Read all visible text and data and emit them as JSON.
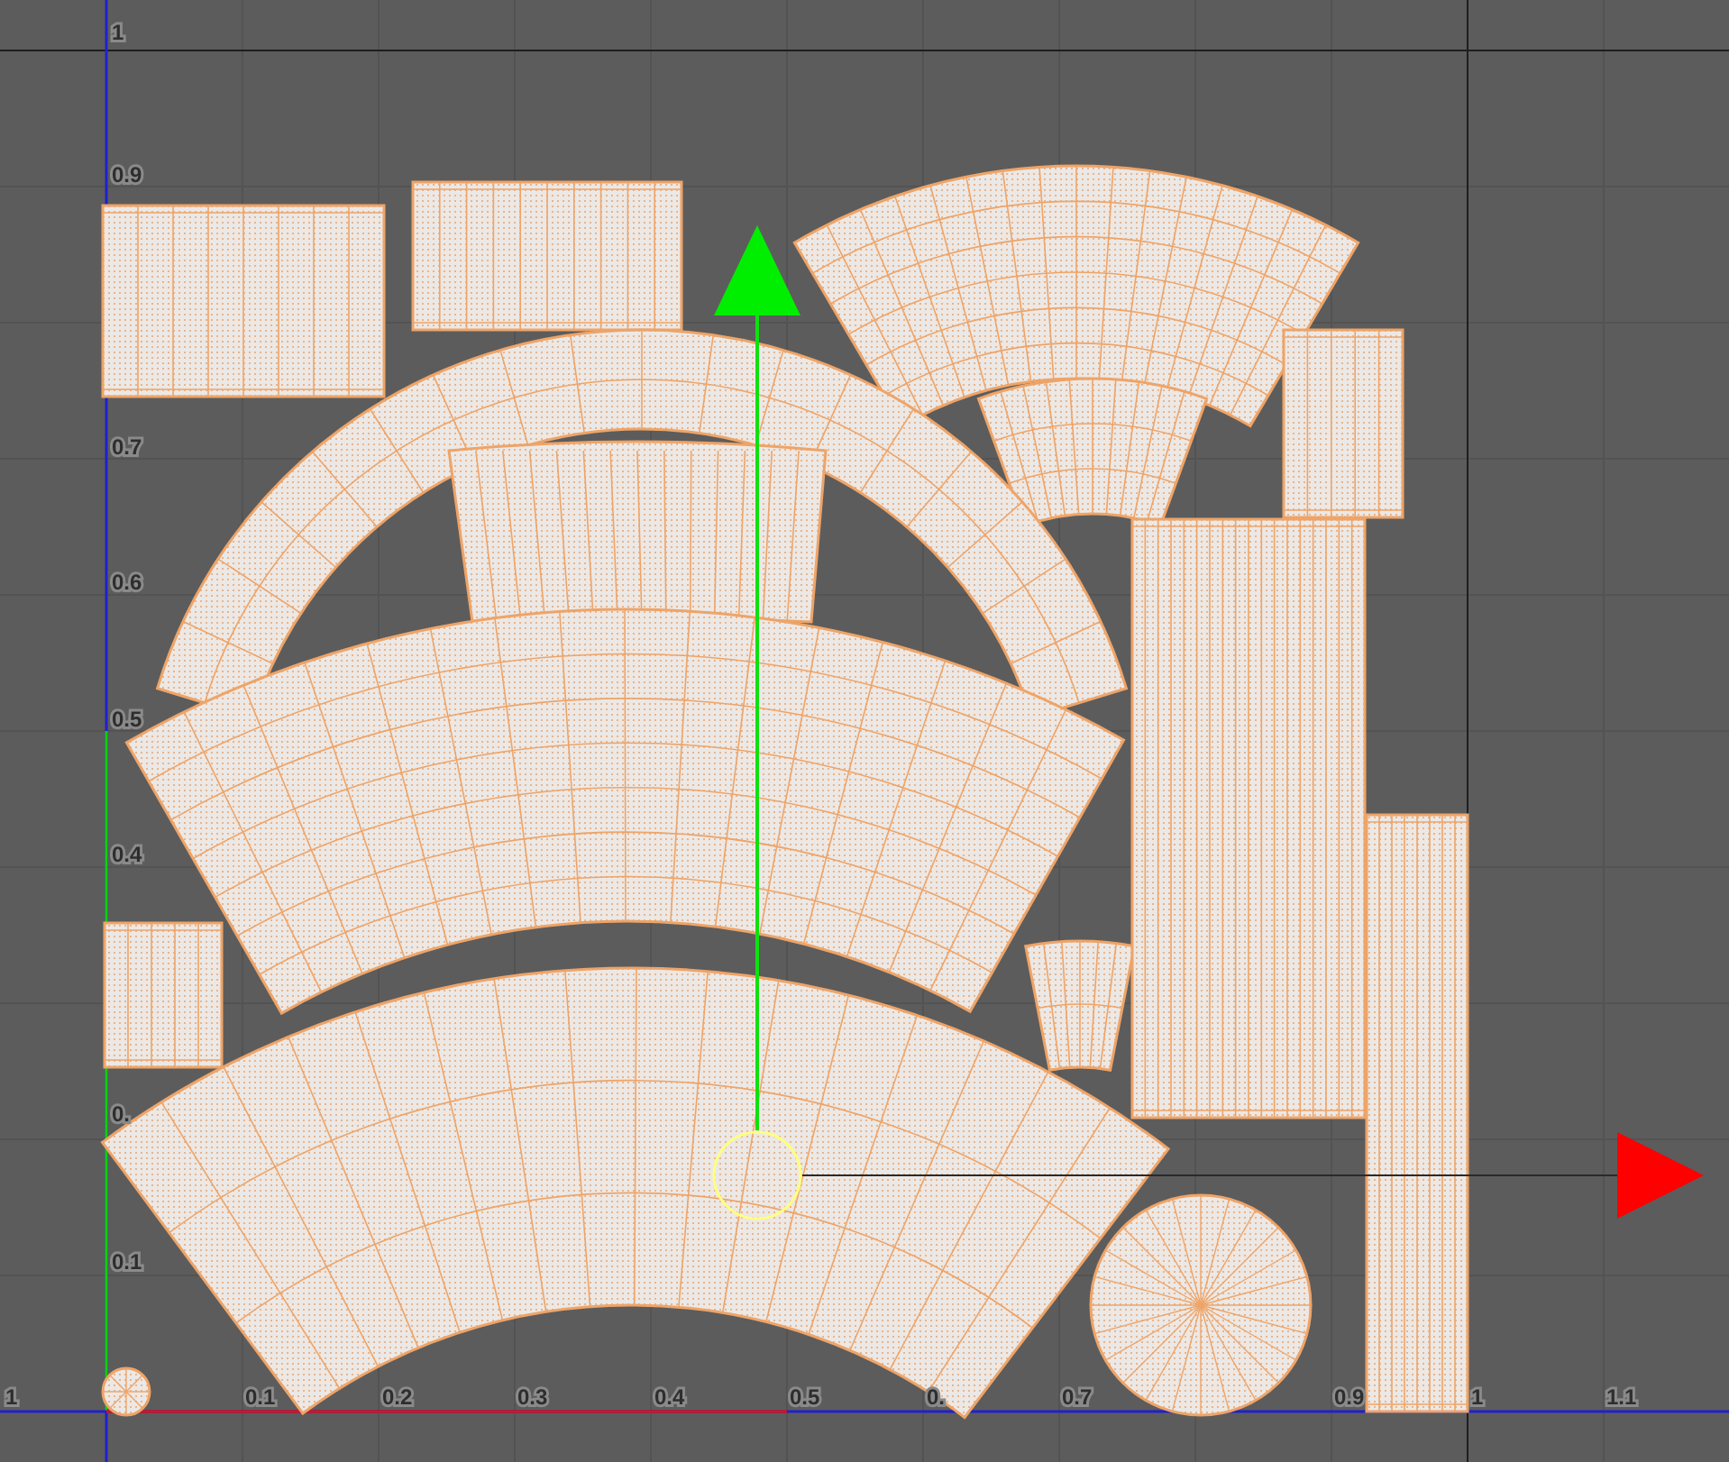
{
  "viewport": {
    "v_axis_labels": [
      "1",
      "0.9",
      "0.7",
      "0.6",
      "0.5",
      "0.4",
      "0.",
      "0.1"
    ],
    "u_axis_labels": [
      "1",
      "0.1",
      "0.2",
      "0.3",
      "0.4",
      "0.5",
      "0.",
      "0.7",
      "0.9",
      "1",
      "1.1"
    ]
  }
}
